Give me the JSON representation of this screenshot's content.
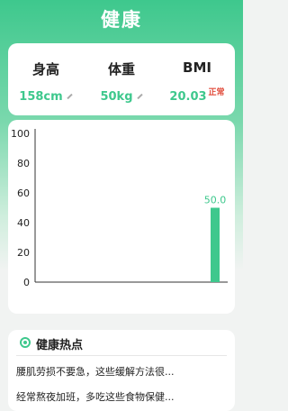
{
  "header": {
    "title": "健康"
  },
  "metrics": {
    "height": {
      "label": "身高",
      "value": "158cm",
      "edit_icon": "pencil-icon"
    },
    "weight": {
      "label": "体重",
      "value": "50kg",
      "edit_icon": "pencil-icon"
    },
    "bmi": {
      "label": "BMI",
      "value": "20.03",
      "status": "正常",
      "status_color": "#e14b3b"
    }
  },
  "colors": {
    "accent": "#3ec88d",
    "status": "#e14b3b"
  },
  "chart_data": {
    "type": "bar",
    "categories": [
      ""
    ],
    "values": [
      50.0
    ],
    "value_labels": [
      "50.0"
    ],
    "y_ticks": [
      "100",
      "80",
      "60",
      "40",
      "20",
      "0"
    ],
    "ylim": [
      0,
      100
    ],
    "bar_color": "#3ec88d",
    "title": "",
    "xlabel": "",
    "ylabel": ""
  },
  "news": {
    "title": "健康热点",
    "icon": "target-icon",
    "items": [
      "腰肌劳损不要急，这些缓解方法很...",
      "经常熬夜加班，多吃这些食物保健..."
    ]
  }
}
